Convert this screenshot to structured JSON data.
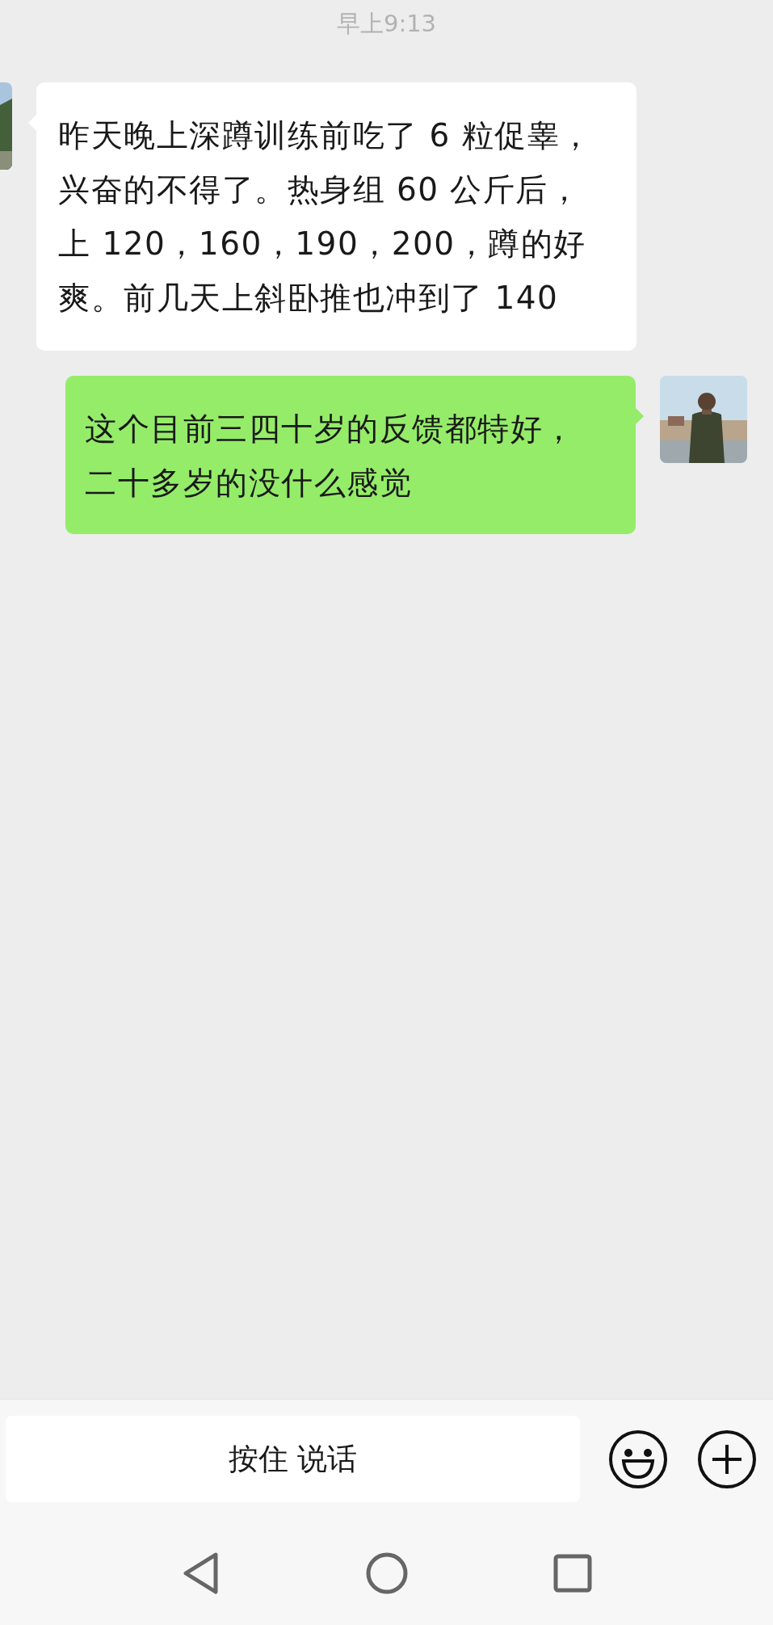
{
  "timestamp": "早上9:13",
  "messages": [
    {
      "kind": "incoming",
      "lines": [
        "昨天晚上深蹲训练前吃了 6 粒促睾，",
        "兴奋的不得了。热身组 60 公斤后，",
        "上 120，160，190，200，蹲的好",
        "爽。前几天上斜卧推也冲到了 140"
      ]
    },
    {
      "kind": "outgoing",
      "lines": [
        "这个目前三四十岁的反馈都特好，",
        "二十多岁的没什么感觉"
      ]
    }
  ],
  "input_bar": {
    "voice_button": "按住 说话"
  }
}
